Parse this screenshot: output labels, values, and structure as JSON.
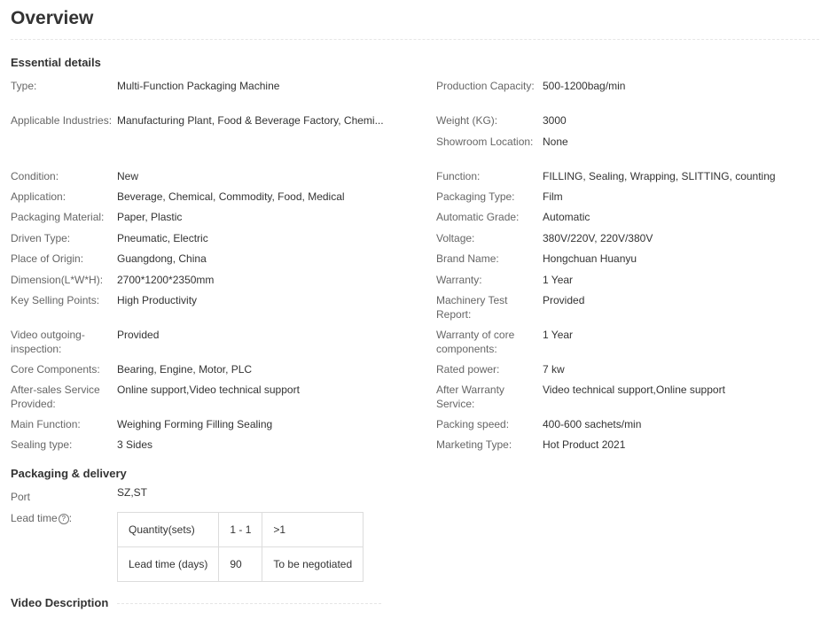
{
  "page_title": "Overview",
  "essential_details": {
    "heading": "Essential details",
    "left": [
      {
        "label": "Type:",
        "value": "Multi-Function Packaging Machine"
      },
      {
        "label": "Applicable Industries:",
        "value": "Manufacturing Plant, Food & Beverage Factory, Chemi..."
      },
      {
        "label": "Condition:",
        "value": "New"
      },
      {
        "label": "Application:",
        "value": "Beverage, Chemical, Commodity, Food, Medical"
      },
      {
        "label": "Packaging Material:",
        "value": "Paper, Plastic"
      },
      {
        "label": "Driven Type:",
        "value": "Pneumatic, Electric"
      },
      {
        "label": "Place of Origin:",
        "value": "Guangdong, China"
      },
      {
        "label": "Dimension(L*W*H):",
        "value": "2700*1200*2350mm"
      },
      {
        "label": "Key Selling Points:",
        "value": "High Productivity"
      },
      {
        "label": "Video outgoing-inspection:",
        "value": "Provided"
      },
      {
        "label": "Core Components:",
        "value": "Bearing, Engine, Motor, PLC"
      },
      {
        "label": "After-sales Service Provided:",
        "value": "Online support,Video technical support"
      },
      {
        "label": "Main Function:",
        "value": "Weighing Forming Filling Sealing"
      },
      {
        "label": "Sealing type:",
        "value": "3 Sides"
      }
    ],
    "right": [
      {
        "label": "Production Capacity:",
        "value": "500-1200bag/min"
      },
      {
        "label": "Weight (KG):",
        "value": "3000"
      },
      {
        "label": "Showroom Location:",
        "value": "None"
      },
      {
        "label": "Function:",
        "value": "FILLING, Sealing, Wrapping, SLITTING, counting"
      },
      {
        "label": "Packaging Type:",
        "value": "Film"
      },
      {
        "label": "Automatic Grade:",
        "value": "Automatic"
      },
      {
        "label": "Voltage:",
        "value": "380V/220V, 220V/380V"
      },
      {
        "label": "Brand Name:",
        "value": "Hongchuan Huanyu"
      },
      {
        "label": "Warranty:",
        "value": "1 Year"
      },
      {
        "label": "Machinery Test Report:",
        "value": "Provided"
      },
      {
        "label": "Warranty of core components:",
        "value": "1 Year"
      },
      {
        "label": "Rated power:",
        "value": "7 kw"
      },
      {
        "label": "After Warranty Service:",
        "value": "Video technical support,Online support"
      },
      {
        "label": "Packing speed:",
        "value": "400-600 sachets/min"
      },
      {
        "label": "Marketing Type:",
        "value": "Hot Product 2021"
      }
    ]
  },
  "packaging_delivery": {
    "heading": "Packaging & delivery",
    "port_label": "Port",
    "port_value": "SZ,ST",
    "lead_time_label": "Lead time",
    "help_icon": "?",
    "lead_table": {
      "quantity_label": "Quantity(sets)",
      "quantities": [
        "1 - 1",
        ">1"
      ],
      "lead_label": "Lead time (days)",
      "days": [
        "90",
        "To be negotiated"
      ]
    }
  },
  "video_description": {
    "heading": "Video Description"
  }
}
